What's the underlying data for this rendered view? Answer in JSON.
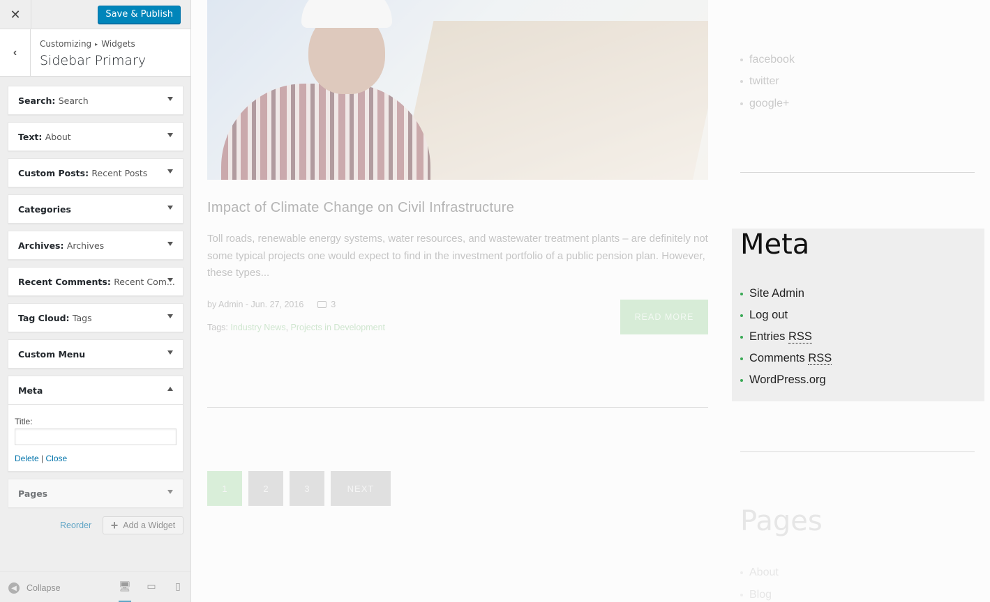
{
  "customizer": {
    "close_icon": "close-icon",
    "save_label": "Save & Publish",
    "breadcrumb_root": "Customizing",
    "breadcrumb_sep": "▸",
    "breadcrumb_child": "Widgets",
    "section_title": "Sidebar Primary",
    "widgets": [
      {
        "type": "Search",
        "instance": "Search"
      },
      {
        "type": "Text",
        "instance": "About"
      },
      {
        "type": "Custom Posts",
        "instance": "Recent Posts"
      },
      {
        "type": "Categories",
        "instance": ""
      },
      {
        "type": "Archives",
        "instance": "Archives"
      },
      {
        "type": "Recent Comments",
        "instance": "Recent Com..."
      },
      {
        "type": "Tag Cloud",
        "instance": "Tags"
      },
      {
        "type": "Custom Menu",
        "instance": ""
      },
      {
        "type": "Meta",
        "instance": ""
      },
      {
        "type": "Pages",
        "instance": ""
      }
    ],
    "meta_form": {
      "title_label": "Title:",
      "title_value": "",
      "delete_label": "Delete",
      "separator": "|",
      "close_label": "Close"
    },
    "reorder_label": "Reorder",
    "add_widget_label": "Add a Widget",
    "collapse_label": "Collapse"
  },
  "preview": {
    "post": {
      "title": "Impact of Climate Change on Civil Infrastructure",
      "excerpt": "Toll roads, renewable energy systems, water resources, and wastewater treatment plants – are definitely not some typical projects one would expect to find in the investment portfolio of a public pension plan. However, these types...",
      "byline": "by Admin - Jun. 27, 2016",
      "comment_count": "3",
      "tags_label": "Tags:",
      "tag_1": "Industry News",
      "tag_sep": ",",
      "tag_2": "Projects in Development",
      "read_more": "READ MORE"
    },
    "pagination": {
      "p1": "1",
      "p2": "2",
      "p3": "3",
      "next": "NEXT"
    },
    "social_links": [
      "facebook",
      "twitter",
      "google+"
    ],
    "meta_widget": {
      "title": "Meta",
      "site_admin": "Site Admin",
      "log_out": "Log out",
      "entries": "Entries",
      "comments": "Comments",
      "rss": "RSS",
      "wordpress": "WordPress.org"
    },
    "pages_widget": {
      "title": "Pages",
      "items": [
        "About",
        "Blog"
      ]
    }
  },
  "colors": {
    "accent_blue": "#0085ba",
    "accent_green": "#3aa956",
    "link_blue": "#0073aa"
  }
}
